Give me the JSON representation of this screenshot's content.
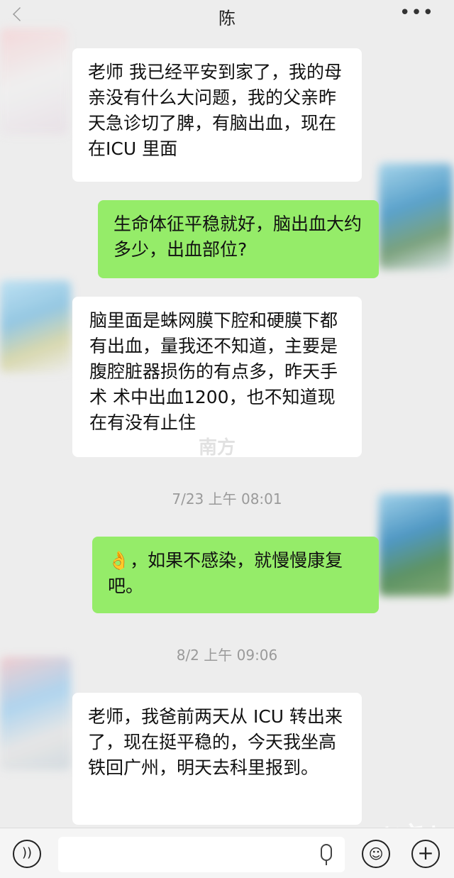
{
  "header": {
    "title": "陈",
    "more_label": "•••"
  },
  "messages": [
    {
      "side": "left",
      "text": "老师 我已经平安到家了，我的母亲没有什么大问题，我的父亲昨天急诊切了脾，有脑出血，现在在ICU 里面"
    },
    {
      "side": "right",
      "text": "生命体征平稳就好，脑出血大约多少，出血部位?"
    },
    {
      "side": "left",
      "text": "脑里面是蛛网膜下腔和硬膜下都有出血，量我还不知道，主要是腹腔脏器损伤的有点多，昨天手术 术中出血1200，也不知道现在有没有止住"
    },
    {
      "side": "right",
      "emoji": "👌",
      "text": "，如果不感染，就慢慢康复吧。"
    },
    {
      "side": "left",
      "text": "老师，我爸前两天从 ICU 转出来了，现在挺平稳的，今天我坐高铁回广州，明天去科里报到。"
    }
  ],
  "timestamps": [
    "7/23 上午 08:01",
    "8/2 上午 09:06"
  ],
  "watermarks": [
    "南方",
    "南方+"
  ],
  "input": {
    "voice_icon": "voice-icon",
    "mic_icon": "microphone-icon",
    "emoji_icon": "emoji-icon",
    "plus_icon": "plus-icon",
    "plus_label": "+"
  }
}
